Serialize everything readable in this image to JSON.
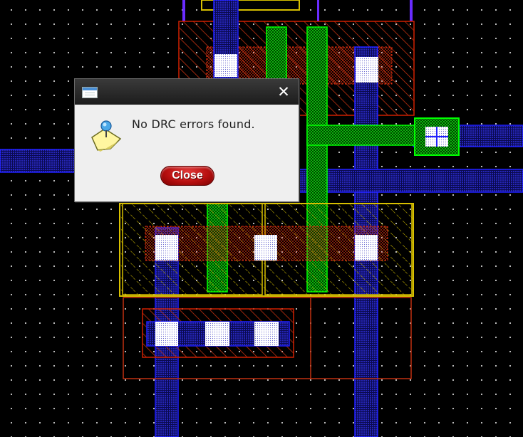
{
  "dialog": {
    "message": "No DRC errors found.",
    "close_button_label": "Close",
    "window_icon": "window-icon",
    "close_icon": "close-icon",
    "message_icon": "pushpin-note-icon"
  },
  "layout_view": {
    "description_layers": [
      "metal1",
      "poly",
      "active",
      "contact",
      "nwell"
    ],
    "colors": {
      "background": "#000000",
      "grid_dots": "#cfcfcf",
      "metal": "#2020ff",
      "poly": "#00e000",
      "contact": "#ffffff",
      "active": "#d02000",
      "well": "#e0d000",
      "dialog_button": "#b81010"
    }
  }
}
